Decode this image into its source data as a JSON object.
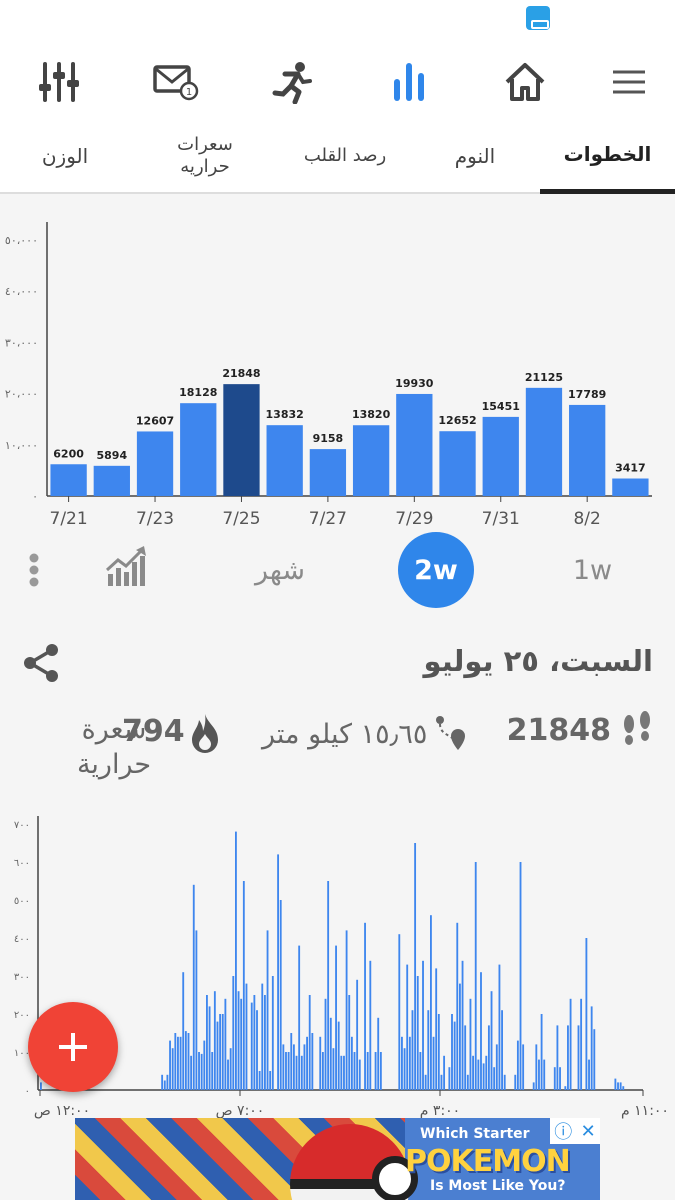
{
  "toolbar": {
    "icons": [
      "menu-icon",
      "home-icon",
      "chart-icon",
      "activity-icon",
      "mail-icon",
      "sliders-icon"
    ],
    "active_icon": "chart-icon",
    "accent_color": "#2f86ea"
  },
  "tabs": [
    {
      "label": "الخطوات",
      "active": true
    },
    {
      "label": "النوم",
      "active": false
    },
    {
      "label": "رصد القلب",
      "active": false
    },
    {
      "label": "سعرات حراريه",
      "active": false
    },
    {
      "label": "الوزن",
      "active": false
    }
  ],
  "range": {
    "w1": "1w",
    "w2": "2w",
    "month": "شهر",
    "selected": "2w"
  },
  "date": {
    "title": "السبت، ٢٥ يوليو"
  },
  "stats": {
    "steps": "21848",
    "distance": "١٥٫٦٥ كيلو متر",
    "calories_value": "794",
    "calories_unit": "سعرة حرارية"
  },
  "chart_data": [
    {
      "type": "bar",
      "title": "",
      "xlabel": "",
      "ylabel": "",
      "ylim": [
        0,
        50000
      ],
      "yticks": [
        "٥٠،٠٠٠",
        "٤٠،٠٠٠",
        "٣٠،٠٠٠",
        "٢٠،٠٠٠",
        "١٠،٠٠٠",
        "٠"
      ],
      "xticks": [
        "7/21",
        "7/23",
        "7/25",
        "7/27",
        "7/29",
        "7/31",
        "8/2"
      ],
      "values": [
        6200,
        5894,
        12607,
        18128,
        21848,
        13832,
        9158,
        13820,
        19930,
        12652,
        15451,
        21125,
        17789,
        3417
      ],
      "highlight_index": 4,
      "bar_color": "#3e86ee",
      "highlight_color": "#1e4a8c",
      "grid": false
    },
    {
      "type": "bar",
      "title": "",
      "ylim": [
        0,
        700
      ],
      "yticks": [
        "٧٠٠",
        "٦٠٠",
        "٥٠٠",
        "٤٠٠",
        "٣٠٠",
        "٢٠٠",
        "١٠٠",
        "٠"
      ],
      "xticks": [
        "١٢:٠٠ ص",
        "٧:٠٠ ص",
        "٣:٠٠ م",
        "١١:٠٠ م"
      ],
      "values": [
        20,
        0,
        0,
        0,
        0,
        0,
        0,
        0,
        0,
        0,
        0,
        0,
        0,
        0,
        0,
        0,
        0,
        0,
        0,
        0,
        0,
        0,
        0,
        0,
        0,
        0,
        0,
        0,
        0,
        0,
        0,
        0,
        0,
        0,
        0,
        0,
        0,
        0,
        0,
        0,
        0,
        0,
        0,
        0,
        0,
        0,
        40,
        25,
        40,
        130,
        110,
        150,
        140,
        140,
        310,
        155,
        150,
        90,
        540,
        420,
        100,
        95,
        130,
        250,
        220,
        100,
        260,
        180,
        200,
        200,
        240,
        80,
        110,
        300,
        680,
        260,
        240,
        550,
        280,
        0,
        230,
        250,
        210,
        50,
        280,
        250,
        420,
        50,
        300,
        0,
        620,
        500,
        120,
        100,
        100,
        150,
        120,
        90,
        380,
        90,
        120,
        140,
        250,
        150,
        0,
        0,
        140,
        100,
        240,
        550,
        190,
        110,
        380,
        180,
        90,
        90,
        420,
        250,
        140,
        100,
        290,
        80,
        0,
        440,
        100,
        340,
        0,
        100,
        190,
        100,
        0,
        0,
        0,
        0,
        0,
        0,
        410,
        140,
        110,
        330,
        140,
        210,
        650,
        300,
        100,
        340,
        40,
        210,
        460,
        140,
        320,
        200,
        40,
        90,
        0,
        60,
        200,
        180,
        440,
        280,
        340,
        170,
        40,
        240,
        90,
        600,
        80,
        310,
        70,
        90,
        170,
        260,
        60,
        120,
        330,
        210,
        40,
        0,
        0,
        0,
        40,
        130,
        600,
        120,
        0,
        0,
        0,
        20,
        120,
        80,
        200,
        80,
        0,
        0,
        0,
        60,
        170,
        60,
        0,
        10,
        170,
        240,
        0,
        0,
        170,
        240,
        0,
        400,
        80,
        220,
        160,
        0,
        0,
        0,
        0,
        0,
        0,
        0,
        30,
        20,
        20,
        10
      ],
      "bar_color": "#3e86ee"
    }
  ],
  "ad": {
    "line1": "Which Starter",
    "line2": "POKEMON",
    "line3": "Is Most Like You?",
    "info": "ⓘ",
    "close": "✕"
  }
}
